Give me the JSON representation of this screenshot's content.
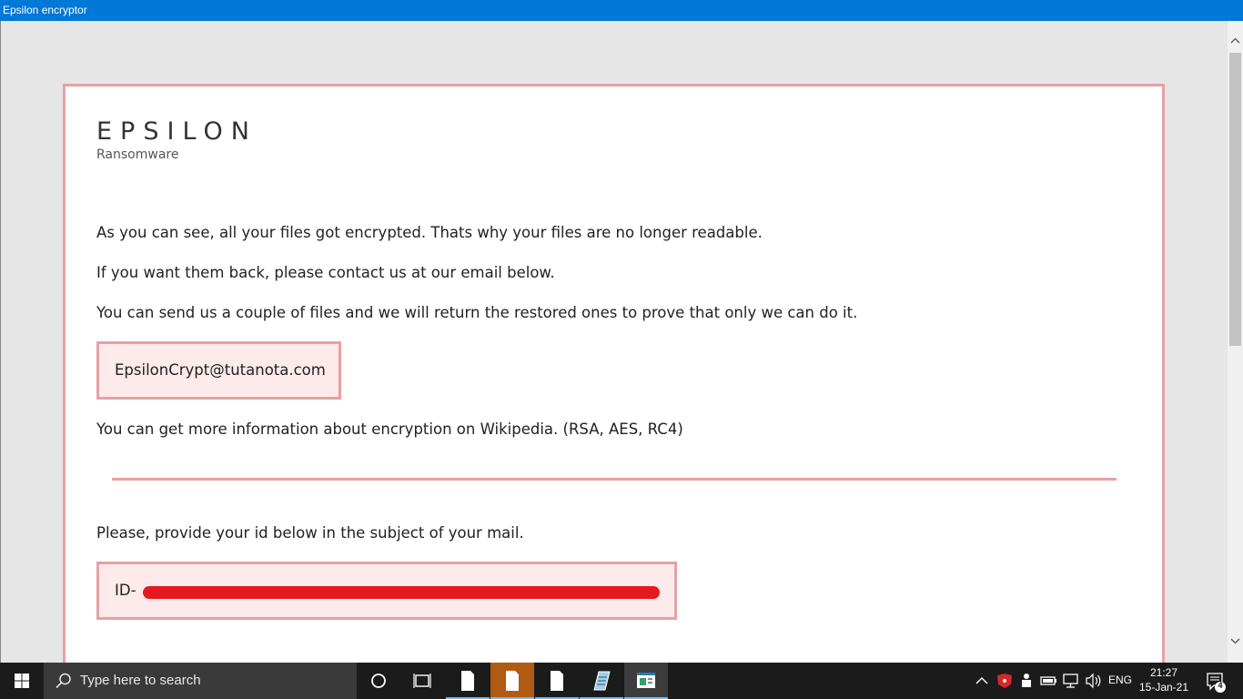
{
  "window": {
    "title": "Epsilon encryptor"
  },
  "note": {
    "brand_title": "EPSILON",
    "brand_subtitle": "Ransomware",
    "para1": "As you can see, all your files got encrypted. Thats why your files are no longer readable.",
    "para2": "If you want them back, please contact us at our email below.",
    "para3": "You can send us a couple of files and we will return the restored ones to prove that only we can do it.",
    "email": "EpsilonCrypt@tutanota.com",
    "para4": "You can get more information about encryption on Wikipedia. (RSA, AES, RC4)",
    "para5": "Please, provide your id below in the subject of your mail.",
    "id_prefix": "ID-"
  },
  "taskbar": {
    "search_placeholder": "Type here to search",
    "language": "ENG",
    "time": "21:27",
    "date": "15-Jan-21",
    "notification_count": "4"
  },
  "colors": {
    "titlebar": "#0078d7",
    "accent_border": "#e8a0a4",
    "box_fill": "#fdeaea",
    "redaction": "#e5191f",
    "taskbar": "#1b1b1b"
  }
}
